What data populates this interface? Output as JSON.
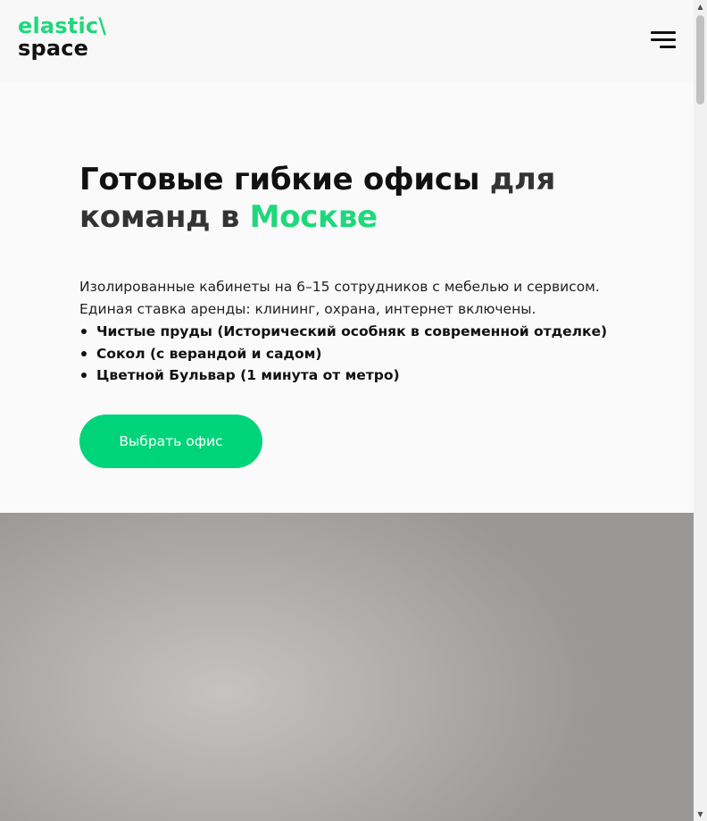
{
  "header": {
    "logo_line1": "elastic\\",
    "logo_line2": "space",
    "menu_icon": "hamburger-menu-icon"
  },
  "hero": {
    "title_part1": "Готовые гибкие офисы ",
    "title_part2": "для команд в ",
    "title_part3": "Москве",
    "description_line1": "Изолированные кабинеты на 6–15 сотрудников с мебелью и сервисом.",
    "description_line2": "Единая ставка аренды: клининг, охрана, интернет включены.",
    "features": [
      "Чистые пруды (Исторический особняк в современной отделке)",
      "Сокол (с верандой и садом)",
      "Цветной Бульвар (1 минута от метро)"
    ],
    "cta_label": "Выбрать офис"
  },
  "colors": {
    "accent": "#1fd87c",
    "button": "#00d47a",
    "text": "#111111"
  },
  "scrollbar": {
    "up_arrow": "▲",
    "down_arrow": "▼"
  }
}
